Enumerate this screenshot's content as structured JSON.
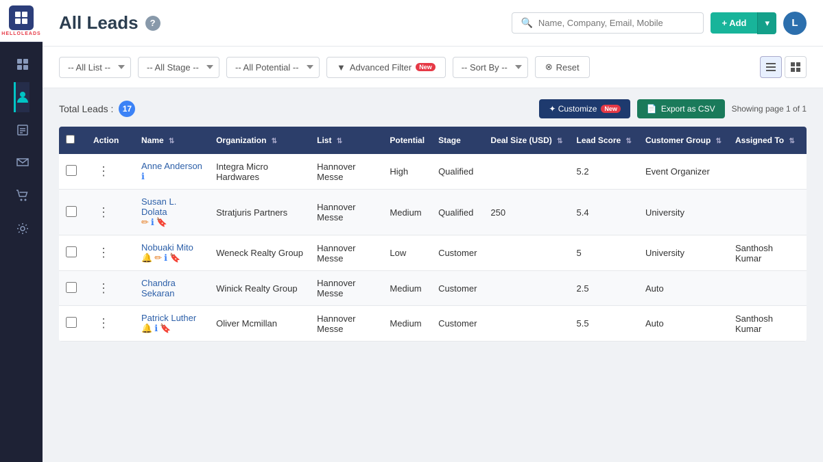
{
  "sidebar": {
    "logo_text": "HELLOLEADS",
    "items": [
      {
        "id": "dashboard",
        "icon": "⊞",
        "active": false
      },
      {
        "id": "contacts",
        "icon": "👥",
        "active": true
      },
      {
        "id": "reports",
        "icon": "📋",
        "active": false
      },
      {
        "id": "messages",
        "icon": "✉",
        "active": false
      },
      {
        "id": "cart",
        "icon": "🛒",
        "active": false
      },
      {
        "id": "settings",
        "icon": "⚙",
        "active": false
      }
    ]
  },
  "header": {
    "title": "All Leads",
    "help_tooltip": "?",
    "search_placeholder": "Name, Company, Email, Mobile",
    "add_button_label": "+ Add",
    "user_initial": "L"
  },
  "filters": {
    "list_label": "-- All List --",
    "stage_label": "-- All Stage --",
    "potential_label": "-- All Potential --",
    "advanced_filter_label": "Advanced Filter",
    "advanced_filter_badge": "New",
    "sort_by_label": "-- Sort By --",
    "reset_label": "Reset"
  },
  "table_toolbar": {
    "total_leads_label": "Total Leads :",
    "leads_count": "17",
    "customize_label": "✦ Customize",
    "customize_badge": "New",
    "export_label": "Export as CSV",
    "page_info": "Showing page 1 of 1"
  },
  "table": {
    "columns": [
      {
        "id": "action",
        "label": "Action"
      },
      {
        "id": "name",
        "label": "Name",
        "sortable": true
      },
      {
        "id": "organization",
        "label": "Organization",
        "sortable": true
      },
      {
        "id": "list",
        "label": "List",
        "sortable": true
      },
      {
        "id": "potential",
        "label": "Potential"
      },
      {
        "id": "stage",
        "label": "Stage"
      },
      {
        "id": "deal_size",
        "label": "Deal Size (USD)",
        "sortable": true
      },
      {
        "id": "lead_score",
        "label": "Lead Score",
        "sortable": true
      },
      {
        "id": "customer_group",
        "label": "Customer Group",
        "sortable": true
      },
      {
        "id": "assigned_to",
        "label": "Assigned To",
        "sortable": true
      }
    ],
    "rows": [
      {
        "name": "Anne Anderson",
        "icons": [
          "info"
        ],
        "organization": "Integra Micro Hardwares",
        "list": "Hannover Messe",
        "potential": "High",
        "stage": "Qualified",
        "deal_size": "",
        "lead_score": "5.2",
        "customer_group": "Event Organizer",
        "assigned_to": ""
      },
      {
        "name": "Susan L. Dolata",
        "icons": [
          "edit",
          "info",
          "bookmark"
        ],
        "organization": "Stratjuris Partners",
        "list": "Hannover Messe",
        "potential": "Medium",
        "stage": "Qualified",
        "deal_size": "250",
        "lead_score": "5.4",
        "customer_group": "University",
        "assigned_to": ""
      },
      {
        "name": "Nobuaki Mito",
        "icons": [
          "bell",
          "edit",
          "info",
          "bookmark"
        ],
        "organization": "Weneck Realty Group",
        "list": "Hannover Messe",
        "potential": "Low",
        "stage": "Customer",
        "deal_size": "",
        "lead_score": "5",
        "customer_group": "University",
        "assigned_to": "Santhosh Kumar"
      },
      {
        "name": "Chandra Sekaran",
        "icons": [],
        "organization": "Winick Realty Group",
        "list": "Hannover Messe",
        "potential": "Medium",
        "stage": "Customer",
        "deal_size": "",
        "lead_score": "2.5",
        "customer_group": "Auto",
        "assigned_to": ""
      },
      {
        "name": "Patrick Luther",
        "icons": [
          "bell",
          "info",
          "bookmark"
        ],
        "organization": "Oliver Mcmillan",
        "list": "Hannover Messe",
        "potential": "Medium",
        "stage": "Customer",
        "deal_size": "",
        "lead_score": "5.5",
        "customer_group": "Auto",
        "assigned_to": "Santhosh Kumar"
      }
    ]
  }
}
